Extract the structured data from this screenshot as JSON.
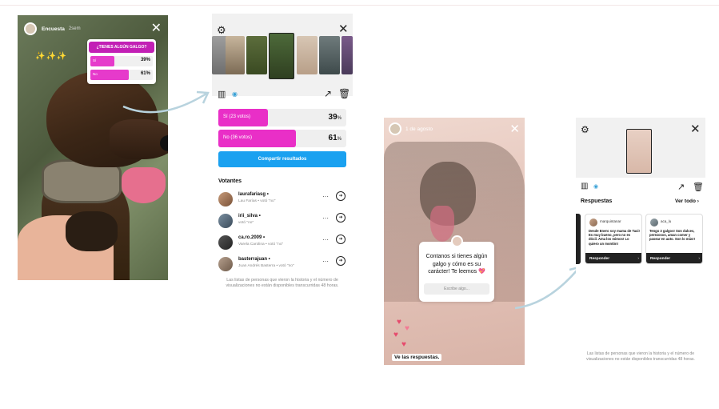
{
  "story1": {
    "username": "Encuesta",
    "time": "2sem",
    "sparkles": "✨✨✨",
    "poll": {
      "question": "¿TIENES ALGÚN GALGO?",
      "options": [
        {
          "label": "Sí",
          "percent": "39",
          "fraction": 0.39
        },
        {
          "label": "No",
          "percent": "61",
          "fraction": 0.61
        }
      ]
    }
  },
  "panel2": {
    "results": [
      {
        "label": "Sí (23 votos)",
        "percent": "39",
        "fraction": 0.39
      },
      {
        "label": "No (36 votos)",
        "percent": "61",
        "fraction": 0.61
      }
    ],
    "share_label": "Compartir resultados",
    "voters_title": "Votantes",
    "voters": [
      {
        "name": "laurafariasg",
        "sub": "Lau Farías • votó \"no\""
      },
      {
        "name": "irii_silva",
        "sub": "votó \"no\""
      },
      {
        "name": "ca.ro.2009",
        "sub": "Varela Carolina • votó \"no\""
      },
      {
        "name": "basterrajuan",
        "sub": "Juan Andrés Basterra • votó \"no\""
      }
    ],
    "footer": "Las listas de personas que vieron la historia y el número de visualizaciones no están disponibles transcurridas 48 horas."
  },
  "story3": {
    "date": "1 de agosto",
    "question": "Contanos si tienes algún galgo y cómo es su carácter! Te leemos 💖",
    "input_placeholder": "Escribe algo...",
    "responses_label": "Ve las respuestas."
  },
  "panel4": {
    "responses_title": "Respuestas",
    "see_all": "Ver todo ›",
    "cards": [
      {
        "user": "marquintanar",
        "text": "Desde Enero soy mama de Taxi! Es muy bueno, pero no es dócil. Ama los mimos! Lo quiero un montón!",
        "button": "Responder"
      },
      {
        "user": "aca_lu",
        "text": "Tengo 3 galgos! Son dulces, perezosos, aman comer y pasear en auto. Son lo más!!",
        "button": "Responder"
      }
    ],
    "footer": "Las listas de personas que vieron la historia y el número de visualizaciones no están disponibles transcurridas 48 horas."
  },
  "colors": {
    "poll_magenta": "#e92fc7",
    "share_blue": "#1aa1f0",
    "arrow": "#b8d3de"
  },
  "icons": [
    "gear-icon",
    "close-icon",
    "bar-chart-icon",
    "eye-icon",
    "trend-icon",
    "trash-icon",
    "more-icon",
    "message-icon",
    "chevron-right-icon",
    "heart-icon",
    "arrow-icon"
  ]
}
